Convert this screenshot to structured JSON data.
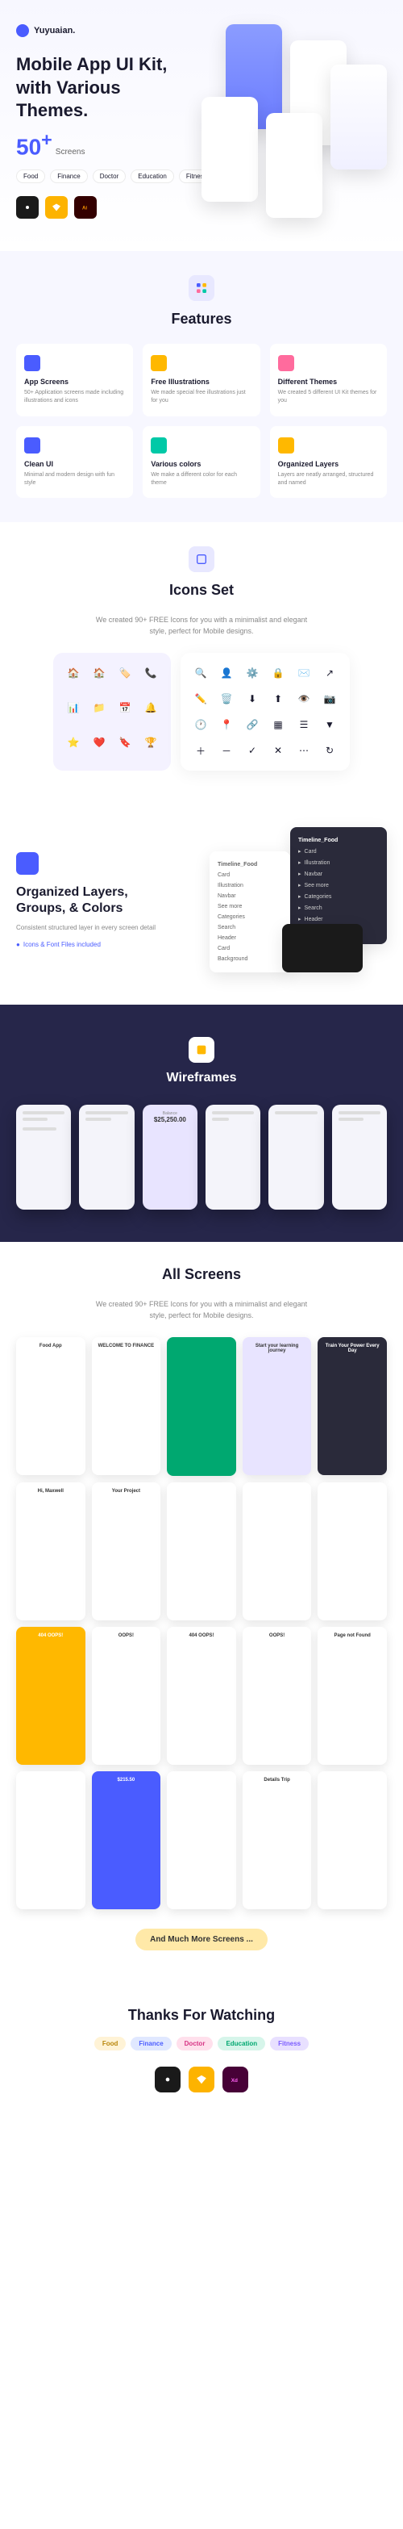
{
  "logo": "Yuyuaian.",
  "hero": {
    "title": "Mobile App UI Kit, with Various Themes.",
    "count": "50",
    "count_suffix": "+",
    "screens_label": "Screens",
    "badges": [
      "Food",
      "Finance",
      "Doctor",
      "Education",
      "Fitness"
    ]
  },
  "features": {
    "title": "Features",
    "items": [
      {
        "name": "App Screens",
        "desc": "50+ Application screens made including illustrations and icons"
      },
      {
        "name": "Free Illustrations",
        "desc": "We made special free illustrations just for you"
      },
      {
        "name": "Different Themes",
        "desc": "We created 5 different UI Kit themes for you"
      },
      {
        "name": "Clean UI",
        "desc": "Minimal and modern design with fun style"
      },
      {
        "name": "Various colors",
        "desc": "We make a different color for each theme"
      },
      {
        "name": "Organized Layers",
        "desc": "Layers are neatly arranged, structured and named"
      }
    ]
  },
  "icons_set": {
    "title": "Icons Set",
    "desc": "We created 90+ FREE Icons for you with a minimalist and elegant style, perfect for Mobile designs."
  },
  "layers": {
    "title": "Organized Layers, Groups, & Colors",
    "sub": "Consistent structured layer in every screen detail",
    "note": "Icons & Font Files included",
    "panel_title": "Timeline_Food",
    "dark_rows": [
      "Timeline_Food",
      "Card",
      "Illustration",
      "Navbar",
      "See more",
      "Categories",
      "Search",
      "Header",
      "Background"
    ],
    "light_rows": [
      "Card",
      "Illustration",
      "Navbar",
      "See more",
      "Categories",
      "Search",
      "Header",
      "Card",
      "Background"
    ]
  },
  "wireframes": {
    "title": "Wireframes",
    "balance_label": "Balance",
    "balance_value": "$25,250.00"
  },
  "all_screens": {
    "title": "All Screens",
    "desc": "We created 90+ FREE Icons for you with a minimalist and elegant style, perfect for Mobile designs.",
    "screens": [
      {
        "title": "Food App",
        "bg": "#fff"
      },
      {
        "title": "WELCOME TO FINANCE",
        "bg": "#fff"
      },
      {
        "title": "",
        "bg": "#00a870"
      },
      {
        "title": "Start your learning journey",
        "bg": "#e8e4ff"
      },
      {
        "title": "Train Your Power Every Day",
        "bg": "#2a2a3a"
      },
      {
        "title": "Hi, Maxwell",
        "bg": "#fff"
      },
      {
        "title": "Your Project",
        "bg": "#fff"
      },
      {
        "title": "",
        "bg": "#fff"
      },
      {
        "title": "",
        "bg": "#fff"
      },
      {
        "title": "",
        "bg": "#fff"
      },
      {
        "title": "404 OOPS!",
        "bg": "#ffb800"
      },
      {
        "title": "OOPS!",
        "bg": "#fff"
      },
      {
        "title": "404 OOPS!",
        "bg": "#fff"
      },
      {
        "title": "OOPS!",
        "bg": "#fff"
      },
      {
        "title": "Page not Found",
        "bg": "#fff"
      },
      {
        "title": "",
        "bg": "#fff"
      },
      {
        "title": "$215.50",
        "bg": "#4a5cff"
      },
      {
        "title": "",
        "bg": "#fff"
      },
      {
        "title": "Details Trip",
        "bg": "#fff"
      },
      {
        "title": "",
        "bg": "#fff"
      }
    ],
    "more_label": "And Much More Screens ..."
  },
  "thanks": {
    "title": "Thanks For Watching",
    "badges": [
      "Food",
      "Finance",
      "Doctor",
      "Education",
      "Fitness"
    ]
  }
}
